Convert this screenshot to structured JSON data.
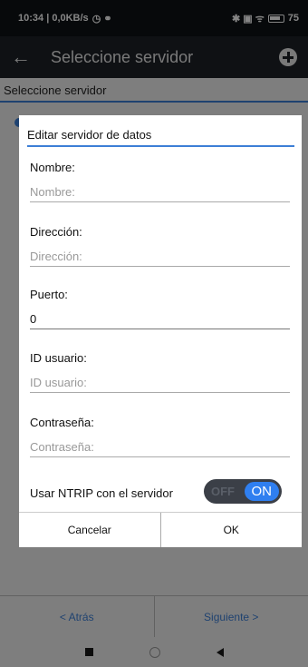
{
  "status_bar": {
    "time_info": "10:34 | 0,0KB/s",
    "left_icons": "◷ ⚭",
    "right_icons": "✱ ▣ ᯤ",
    "battery": "75"
  },
  "app_bar": {
    "title": "Seleccione servidor",
    "back_icon": "←"
  },
  "page": {
    "section_label": "Seleccione servidor"
  },
  "dialog": {
    "title": "Editar servidor de datos",
    "fields": [
      {
        "label": "Nombre:",
        "value": "",
        "placeholder": "Nombre:"
      },
      {
        "label": "Dirección:",
        "value": "",
        "placeholder": "Dirección:"
      },
      {
        "label": "Puerto:",
        "value": "0",
        "placeholder": ""
      },
      {
        "label": "ID usuario:",
        "value": "",
        "placeholder": "ID usuario:"
      },
      {
        "label": "Contraseña:",
        "value": "",
        "placeholder": "Contraseña:"
      }
    ],
    "ntrip_label": "Usar NTRIP con el servidor",
    "toggle_off": "OFF",
    "toggle_on": "ON",
    "cancel": "Cancelar",
    "ok": "OK"
  },
  "bottom_nav": {
    "back": "< Atrás",
    "next": "Siguiente >"
  },
  "colors": {
    "accent": "#3d7fd6",
    "toggle_on": "#2f7ff0"
  }
}
